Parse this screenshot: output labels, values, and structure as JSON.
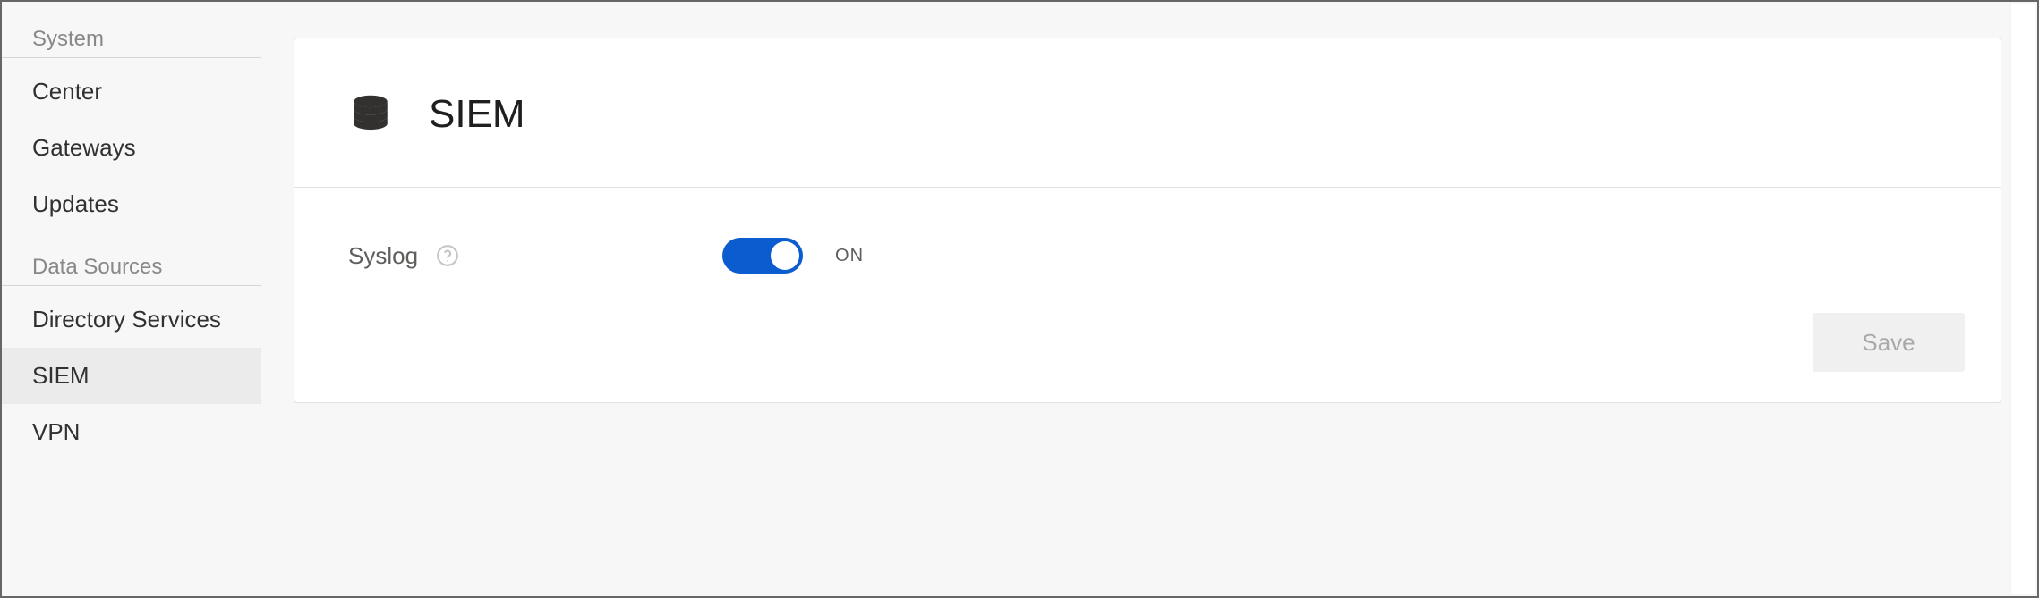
{
  "sidebar": {
    "groups": [
      {
        "header": "System",
        "items": [
          {
            "label": "Center",
            "active": false
          },
          {
            "label": "Gateways",
            "active": false
          },
          {
            "label": "Updates",
            "active": false
          }
        ]
      },
      {
        "header": "Data Sources",
        "items": [
          {
            "label": "Directory Services",
            "active": false
          },
          {
            "label": "SIEM",
            "active": true
          },
          {
            "label": "VPN",
            "active": false
          }
        ]
      }
    ]
  },
  "page": {
    "title": "SIEM",
    "settings": {
      "syslog": {
        "label": "Syslog",
        "state": "ON",
        "on": true
      }
    },
    "save_label": "Save"
  }
}
